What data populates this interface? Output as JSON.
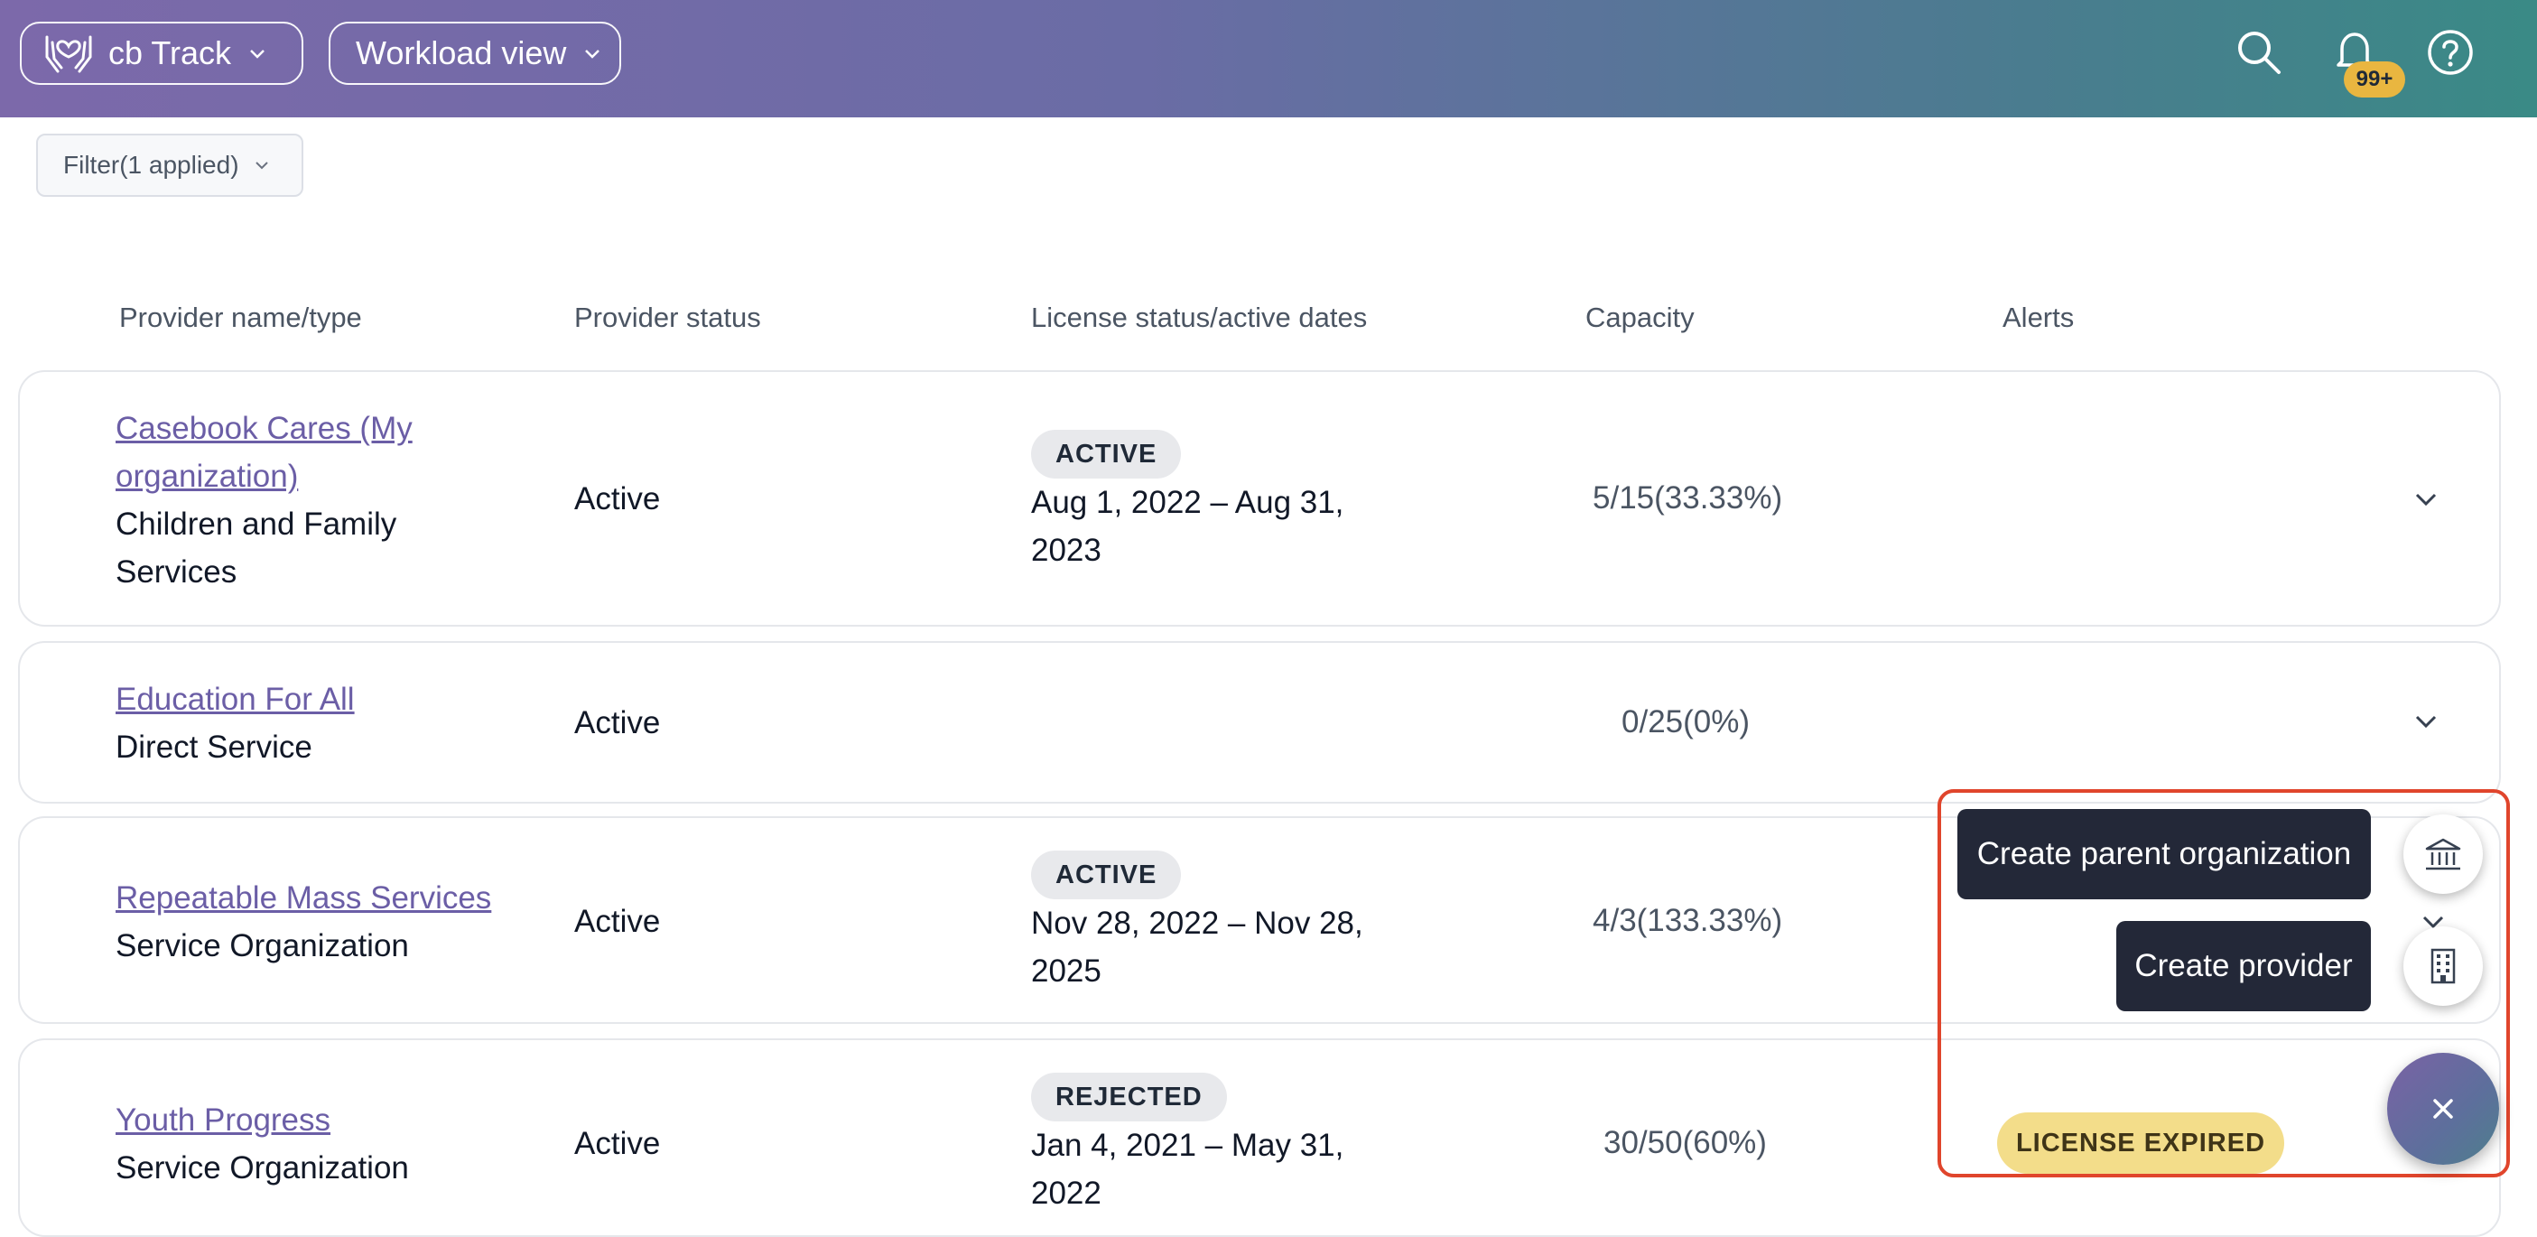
{
  "header": {
    "app_label": "cb Track",
    "view_label": "Workload view",
    "notification_badge": "99+",
    "gradient_colors": [
      "#7c69aa",
      "#3a8a86"
    ]
  },
  "filter": {
    "label": "Filter(1 applied)"
  },
  "table": {
    "columns": [
      "Provider name/type",
      "Provider status",
      "License status/active dates",
      "Capacity",
      "Alerts"
    ],
    "rows": [
      {
        "name": "Casebook Cares (My organization)",
        "type": "Children and Family Services",
        "status": "Active",
        "license_status": "ACTIVE",
        "license_dates": "Aug 1, 2022 – Aug 31, 2023",
        "capacity": "5/15(33.33%)",
        "alert": ""
      },
      {
        "name": "Education For All",
        "type": "Direct Service",
        "status": "Active",
        "license_status": "",
        "license_dates": "",
        "capacity": "0/25(0%)",
        "alert": ""
      },
      {
        "name": "Repeatable Mass Services",
        "type": "Service Organization",
        "status": "Active",
        "license_status": "ACTIVE",
        "license_dates": "Nov 28, 2022 – Nov 28, 2025",
        "capacity": "4/3(133.33%)",
        "alert": ""
      },
      {
        "name": "Youth Progress",
        "type": "Service Organization",
        "status": "Active",
        "license_status": "REJECTED",
        "license_dates": "Jan 4, 2021 – May 31, 2022",
        "capacity": "30/50(60%)",
        "alert": "LICENSE EXPIRED"
      }
    ]
  },
  "fab_menu": {
    "actions": [
      {
        "label": "Create parent organization",
        "icon": "institution-icon"
      },
      {
        "label": "Create provider",
        "icon": "building-icon"
      }
    ],
    "close_icon": "close-icon",
    "highlight_color": "#e0452c"
  }
}
